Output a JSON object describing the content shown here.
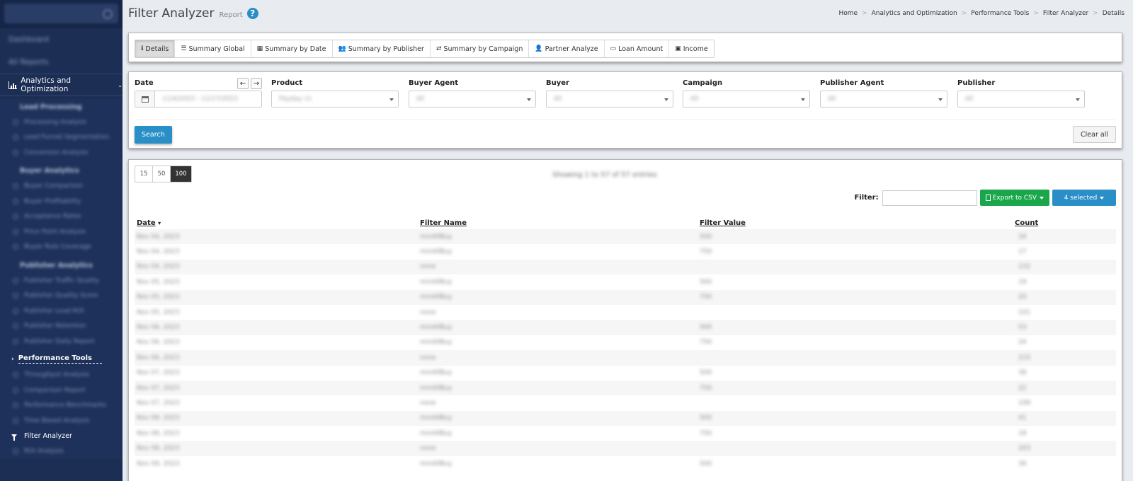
{
  "sidebar": {
    "items_top": [
      "Dashboard",
      "All Reports"
    ],
    "section": "Analytics and Optimization",
    "groups": [
      {
        "title": "Lead Processing",
        "links": [
          "Processing Analysis",
          "Lead Funnel Segmentation",
          "Conversion Analysis"
        ]
      },
      {
        "title": "Buyer Analytics",
        "links": [
          "Buyer Comparison",
          "Buyer Profitability",
          "Acceptance Rates",
          "Price Point Analysis",
          "Buyer Rule Coverage"
        ]
      },
      {
        "title": "Publisher Analytics",
        "links": [
          "Publisher Traffic Quality",
          "Publisher Quality Score",
          "Publisher Lead ROI",
          "Publisher Retention",
          "Publisher Daily Report"
        ]
      }
    ],
    "perf_section": "Performance Tools",
    "perf_links": [
      "Throughput Analysis",
      "Comparison Report",
      "Performance Benchmarks",
      "Time Based Analysis"
    ],
    "active_item": "Filter Analyzer",
    "after_active": "ROI Analysis"
  },
  "header": {
    "title": "Filter Analyzer",
    "subtitle": "Report",
    "help": "?",
    "breadcrumbs": [
      "Home",
      "Analytics and Optimization",
      "Performance Tools",
      "Filter Analyzer",
      "Details"
    ]
  },
  "tabs": [
    {
      "icon": "ℹ",
      "label": "Details",
      "active": true
    },
    {
      "icon": "☰",
      "label": "Summary Global"
    },
    {
      "icon": "▦",
      "label": "Summary by Date"
    },
    {
      "icon": "👥",
      "label": "Summary by Publisher"
    },
    {
      "icon": "⇄",
      "label": "Summary by Campaign"
    },
    {
      "icon": "👤",
      "label": "Partner Analyze"
    },
    {
      "icon": "▭",
      "label": "Loan Amount"
    },
    {
      "icon": "▣",
      "label": "Income"
    }
  ],
  "filters": {
    "date_label": "Date",
    "date_value": "11/4/2023 - 11/17/2023",
    "prev": "←",
    "next": "→",
    "fields": [
      {
        "label": "Product",
        "value": "Payday v1"
      },
      {
        "label": "Buyer Agent",
        "value": "All"
      },
      {
        "label": "Buyer",
        "value": "All"
      },
      {
        "label": "Campaign",
        "value": "All"
      },
      {
        "label": "Publisher Agent",
        "value": "All"
      },
      {
        "label": "Publisher",
        "value": "All"
      }
    ],
    "search_label": "Search",
    "clear_label": "Clear all"
  },
  "table": {
    "page_sizes": [
      "15",
      "50",
      "100"
    ],
    "active_page_size": "100",
    "showing": "Showing 1 to 57 of 57 entries",
    "filter_label": "Filter:",
    "filter_value": "",
    "export_label": "Export to CSV",
    "selected_label": "4 selected",
    "columns": [
      "Date",
      "Filter Name",
      "Filter Value",
      "Count"
    ],
    "rows": [
      [
        "Nov 04, 2023",
        "minAllBuy",
        "500",
        "34"
      ],
      [
        "Nov 04, 2023",
        "minAllBuy",
        "750",
        "17"
      ],
      [
        "Nov 04, 2023",
        "none",
        "",
        "132"
      ],
      [
        "Nov 05, 2023",
        "minAllBuy",
        "500",
        "19"
      ],
      [
        "Nov 05, 2023",
        "minAllBuy",
        "750",
        "20"
      ],
      [
        "Nov 05, 2023",
        "none",
        "",
        "101"
      ],
      [
        "Nov 06, 2023",
        "minAllBuy",
        "500",
        "53"
      ],
      [
        "Nov 06, 2023",
        "minAllBuy",
        "750",
        "24"
      ],
      [
        "Nov 06, 2023",
        "none",
        "",
        "215"
      ],
      [
        "Nov 07, 2023",
        "minAllBuy",
        "500",
        "38"
      ],
      [
        "Nov 07, 2023",
        "minAllBuy",
        "750",
        "22"
      ],
      [
        "Nov 07, 2023",
        "none",
        "",
        "199"
      ],
      [
        "Nov 08, 2023",
        "minAllBuy",
        "500",
        "41"
      ],
      [
        "Nov 08, 2023",
        "minAllBuy",
        "750",
        "18"
      ],
      [
        "Nov 08, 2023",
        "none",
        "",
        "203"
      ],
      [
        "Nov 09, 2023",
        "minAllBuy",
        "500",
        "36"
      ]
    ]
  },
  "colors": {
    "sidebar": "#1c2e54",
    "primary": "#2a8fc7",
    "success": "#1aa64a"
  }
}
